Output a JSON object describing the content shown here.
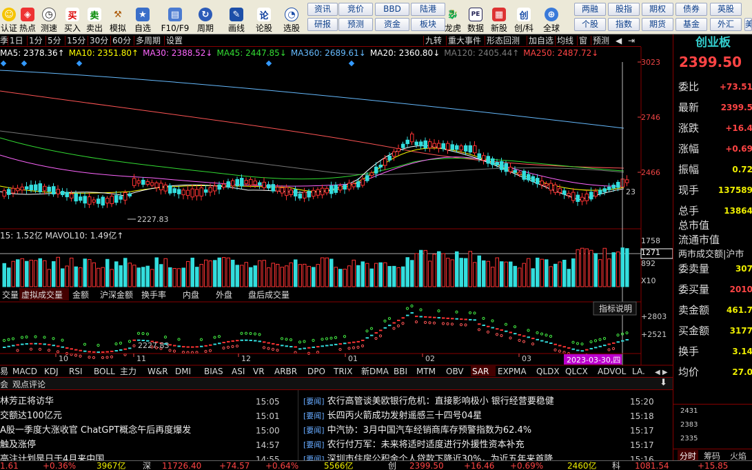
{
  "toolbar": {
    "buttons": [
      {
        "label": "认证",
        "icon": "smile-icon"
      },
      {
        "label": "热点",
        "icon": "hot-icon"
      },
      {
        "label": "测速",
        "icon": "clock-icon"
      },
      {
        "label": "买入",
        "icon": "buy-icon",
        "glyph": "买"
      },
      {
        "label": "卖出",
        "icon": "sell-icon",
        "glyph": "卖"
      },
      {
        "label": "模拟",
        "icon": "hammer-icon"
      },
      {
        "label": "自选",
        "icon": "star-folder-icon"
      },
      {
        "label": "F10/F9",
        "icon": "f10-icon"
      },
      {
        "label": "周期",
        "icon": "period-icon"
      },
      {
        "label": "画线",
        "icon": "pen-icon"
      },
      {
        "label": "论股",
        "icon": "discuss-icon",
        "glyph": "论"
      },
      {
        "label": "选股",
        "icon": "search-chart-icon"
      }
    ],
    "links_row1": [
      "资讯",
      "竞价",
      "BBD",
      "陆港"
    ],
    "links_row2": [
      "研报",
      "预测",
      "资金",
      "板块"
    ],
    "buttons2": [
      {
        "label": "龙虎",
        "icon": "dragon-icon"
      },
      {
        "label": "数据",
        "icon": "pe-icon",
        "glyph": "PE"
      },
      {
        "label": "新股",
        "icon": "new-stock-icon"
      },
      {
        "label": "创/科",
        "icon": "chuang-icon",
        "glyph": "创"
      },
      {
        "label": "全球",
        "icon": "globe-icon"
      }
    ],
    "links2_row1": [
      "两融",
      "股指",
      "期权",
      "债券",
      "英股"
    ],
    "links2_row2": [
      "个股",
      "指数",
      "期货",
      "基金",
      "外汇"
    ],
    "more_label": "美"
  },
  "period_bar": {
    "items": [
      "季",
      "1日",
      "1分",
      "5分",
      "15分",
      "30分",
      "60分",
      "多周期",
      "设置"
    ],
    "right_items": [
      "九转",
      "重大事件",
      "形态回测",
      "加自选",
      "均线",
      "窗",
      "预测"
    ]
  },
  "ma_line": [
    {
      "text": "MA5: 2378.36↑",
      "color": "#ffffff"
    },
    {
      "text": "MA10: 2351.80↑",
      "color": "#ffff00"
    },
    {
      "text": "MA30: 2388.52↓",
      "color": "#ff66ff"
    },
    {
      "text": "MA45: 2447.85↓",
      "color": "#33dd33"
    },
    {
      "text": "MA360: 2689.61↓",
      "color": "#66bbff"
    },
    {
      "text": "MA20: 2360.80↓",
      "color": "#ffffff"
    },
    {
      "text": "MA120: 2405.44↑",
      "color": "#7a7a7a"
    },
    {
      "text": "MA250: 2487.72↓",
      "color": "#ff4444"
    }
  ],
  "price_axis": [
    "3023",
    "2746",
    "2466",
    "23"
  ],
  "low_label": "2227.83",
  "vol_line": "15: 1.52亿  MAVOL10: 1.49亿↑",
  "vol_axis": [
    "1758",
    "1271",
    "892",
    "X10"
  ],
  "vol_tabs": [
    "交量",
    "虚拟成交量",
    "金额",
    "沪深金额",
    "换手率",
    "内盘",
    "外盘",
    "盘后成交量"
  ],
  "vol_tab_active": 1,
  "sar_button": "指标说明",
  "sar_axis": [
    "+2803",
    "+2521"
  ],
  "sar_low_label": "2227.83",
  "month_labels": [
    "10",
    "11",
    "12",
    "01",
    "02",
    "03"
  ],
  "date_cursor": "2023-03-30,四",
  "indicator_tabs": [
    "易",
    "MACD",
    "KDJ",
    "RSI",
    "BOLL",
    "主力",
    "W&R",
    "DMI",
    "BIAS",
    "ASI",
    "VR",
    "ARBR",
    "DPO",
    "TRIX",
    "新DMA",
    "BBI",
    "MTM",
    "OBV",
    "SAR",
    "EXPMA",
    "QLDX",
    "QLCX",
    "ADVOL",
    "LA."
  ],
  "indicator_active": 18,
  "side": {
    "title": "创业板",
    "price": "2399.50",
    "rows": [
      {
        "k": "委比",
        "v": "+73.51",
        "c": "red"
      },
      {
        "k": "最新",
        "v": "2399.5",
        "c": "red"
      },
      {
        "k": "涨跌",
        "v": "+16.4",
        "c": "red"
      },
      {
        "k": "涨幅",
        "v": "+0.69",
        "c": "red"
      },
      {
        "k": "振幅",
        "v": "0.72",
        "c": "yel"
      },
      {
        "k": "现手",
        "v": "137589",
        "c": "yel"
      },
      {
        "k": "总手",
        "v": "13864",
        "c": "yel"
      },
      {
        "k": "总市值",
        "v": "",
        "c": "yel"
      },
      {
        "k": "流通市值",
        "v": "",
        "c": "yel"
      },
      {
        "k": "两市成交额|沪市",
        "v": "",
        "c": "yel"
      },
      {
        "k": "委卖量",
        "v": "307",
        "c": "yel"
      },
      {
        "k": "委买量",
        "v": "2010",
        "c": "red"
      },
      {
        "k": "卖金额",
        "v": "461.7",
        "c": "yel"
      },
      {
        "k": "买金额",
        "v": "3177",
        "c": "yel"
      },
      {
        "k": "换手",
        "v": "3.14",
        "c": "yel"
      },
      {
        "k": "均价",
        "v": "27.0",
        "c": "yel"
      }
    ],
    "mini_axis": [
      "2431",
      "2383",
      "2335"
    ],
    "bottom_tabs": [
      "分时",
      "筹码",
      "火焰"
    ]
  },
  "news": {
    "tabs": [
      "会",
      "观点评论"
    ],
    "left": [
      {
        "title": "林芳正将访华",
        "time": "15:05"
      },
      {
        "title": "交额达100亿元",
        "time": "15:01"
      },
      {
        "title": "A股一季度大涨收官 ChatGPT概念午后再度爆发",
        "time": "15:00"
      },
      {
        "title": "触及涨停",
        "time": "14:57"
      },
      {
        "title": "高注计划是日于4月来中国",
        "time": "14:55"
      }
    ],
    "right": [
      {
        "tag": "[要闻]",
        "title": "农行高管谈美欧银行危机：直接影响极小 银行经营要稳健",
        "time": "15:20"
      },
      {
        "tag": "[要闻]",
        "title": "长四丙火箭成功发射遥感三十四号04星",
        "time": "15:18"
      },
      {
        "tag": "[要闻]",
        "title": "中汽协：3月中国汽车经销商库存预警指数为62.4%",
        "time": "15:17"
      },
      {
        "tag": "[要闻]",
        "title": "农行付万军：未来将适时适度进行外援性资本补充",
        "time": "15:17"
      },
      {
        "tag": "[要闻]",
        "title": "深圳市住房公积金个人贷款下降近30%，为近五年来首降",
        "time": "15:16"
      }
    ]
  },
  "status": [
    {
      "text": "1.61",
      "c": "#f44"
    },
    {
      "text": "+0.36%",
      "c": "#f44"
    },
    {
      "text": "3967亿",
      "c": "#ee0"
    },
    {
      "text": "深",
      "c": "#ddd"
    },
    {
      "text": "11726.40",
      "c": "#f44"
    },
    {
      "text": "+74.57",
      "c": "#f44"
    },
    {
      "text": "+0.64%",
      "c": "#f44"
    },
    {
      "text": "5566亿",
      "c": "#ee0"
    },
    {
      "text": "创",
      "c": "#ddd"
    },
    {
      "text": "2399.50",
      "c": "#f44"
    },
    {
      "text": "+16.46",
      "c": "#f44"
    },
    {
      "text": "+0.69%",
      "c": "#f44"
    },
    {
      "text": "2460亿",
      "c": "#ee0"
    },
    {
      "text": "科",
      "c": "#ddd"
    },
    {
      "text": "1081.54",
      "c": "#f44"
    },
    {
      "text": "+15.85",
      "c": "#f44"
    }
  ]
}
